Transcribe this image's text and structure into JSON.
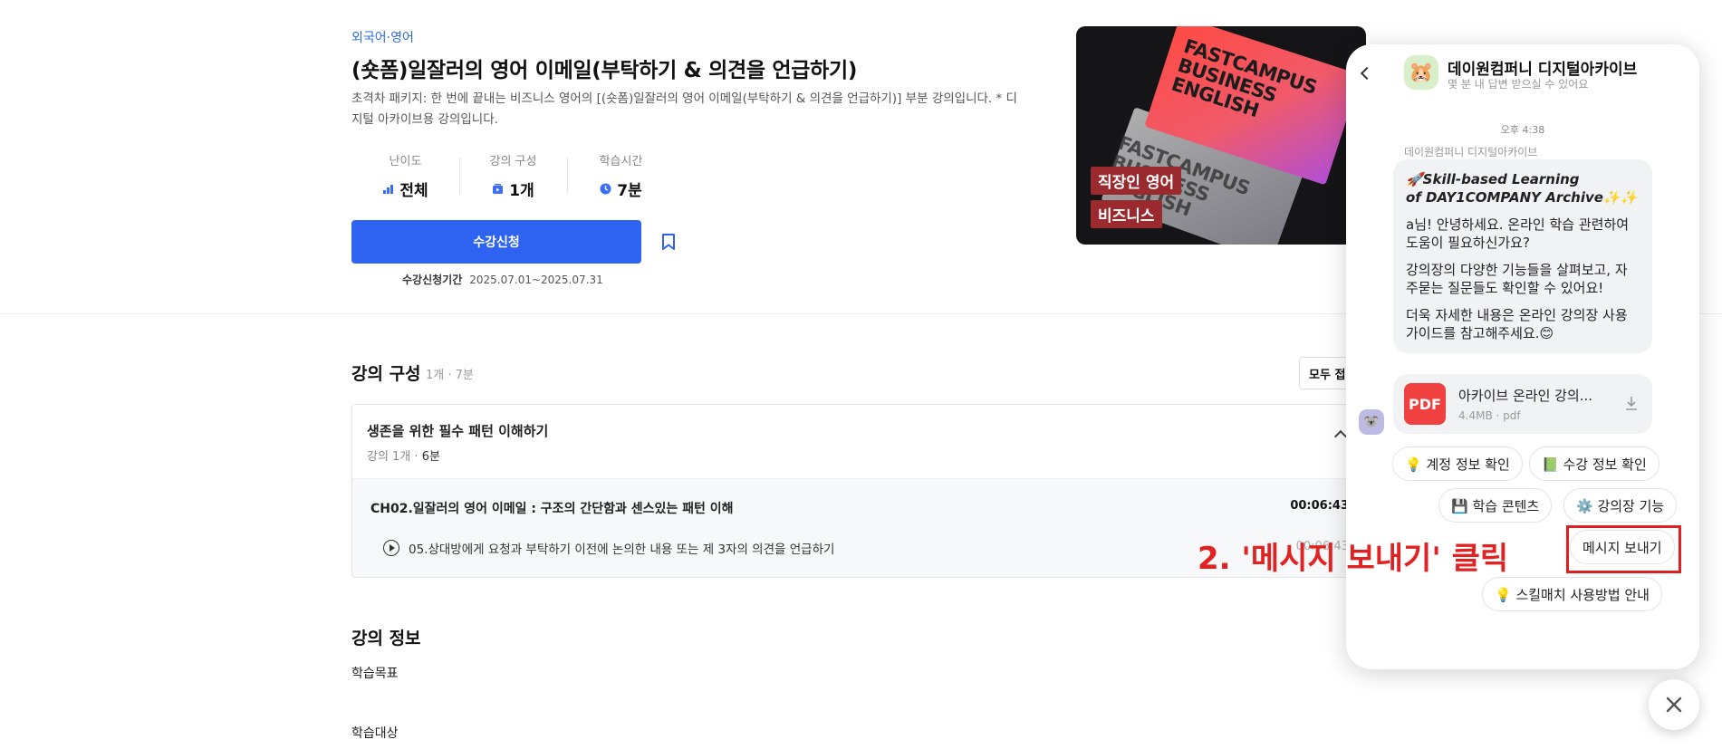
{
  "course": {
    "category": "외국어·영어",
    "title": "(숏폼)일잘러의 영어 이메일(부탁하기 & 의견을 언급하기)",
    "description": "초격차 패키지: 한 번에 끝내는 비즈니스 영어의 [(숏폼)일잘러의 영어 이메일(부탁하기 & 의견을 언급하기)] 부분 강의입니다. * 디지털 아카이브용 강의입니다.",
    "stats": [
      {
        "label": "난이도",
        "value": "전체",
        "icon": "level-bars-icon"
      },
      {
        "label": "강의 구성",
        "value": "1개",
        "icon": "video-stack-icon"
      },
      {
        "label": "학습시간",
        "value": "7분",
        "icon": "clock-icon"
      }
    ],
    "enroll_label": "수강신청",
    "period_label": "수강신청기간",
    "period_value": "2025.07.01~2025.07.31"
  },
  "thumbnail": {
    "card_text_1": "FASTCAMPUS BUSINESS ENGLISH",
    "card_text_2": "FASTCAMPUS BUSINESS ENGLISH",
    "tags": [
      "직장인 영어",
      "비즈니스"
    ]
  },
  "curriculum": {
    "title": "강의 구성",
    "sub": "1개 · 7분",
    "collapse_label": "모두 접",
    "chapter": {
      "title": "생존을 위한 필수 패턴 이해하기",
      "meta_prefix": "강의 1개 · ",
      "meta_time": "6분",
      "sub_title": "CH02.일잘러의 영어 이메일 : 구조의 간단함과 센스있는 패턴 이해",
      "sub_time": "00:06:43",
      "lesson_title": "05.상대방에게 요청과 부탁하기 이전에 논의한 내용 또는 제 3자의 의견을 언급하기",
      "lesson_time": "00:06:43"
    }
  },
  "info": {
    "title": "강의 정보",
    "goal_label": "학습목표",
    "target_label": "학습대상"
  },
  "chat": {
    "name": "데이원컴퍼니 디지털아카이브",
    "status": "몇 분 내 답변 받으실 수 있어요",
    "time": "오후 4:38",
    "sender": "데이원컴퍼니 디지털아카이브",
    "msg_line1": "🚀Skill-based Learning",
    "msg_line2": "of DAY1COMPANY Archive✨✨",
    "msg_p2": "a님! 안녕하세요. 온라인 학습 관련하여 도움이 필요하신가요?",
    "msg_p3": "강의장의 다양한 기능들을 살펴보고, 자주묻는 질문들도 확인할 수 있어요!",
    "msg_p4": "더욱 자세한 내용은 온라인 강의장 사용 가이드를 참고해주세요.😊",
    "file": {
      "badge": "PDF",
      "name": "아카이브 온라인 강의...",
      "meta": "4.4MB · pdf"
    },
    "chips": [
      {
        "label": "💡 계정 정보 확인"
      },
      {
        "label": "📗 수강 정보 확인"
      },
      {
        "label": "💾 학습 콘텐츠"
      },
      {
        "label": "⚙️ 강의장 기능"
      },
      {
        "label": "메시지 보내기"
      },
      {
        "label": "💡 스킬매치 사용방법 안내"
      }
    ]
  },
  "annotation": {
    "text": "2. '메시지 보내기' 클릭",
    "color": "#e02020"
  }
}
